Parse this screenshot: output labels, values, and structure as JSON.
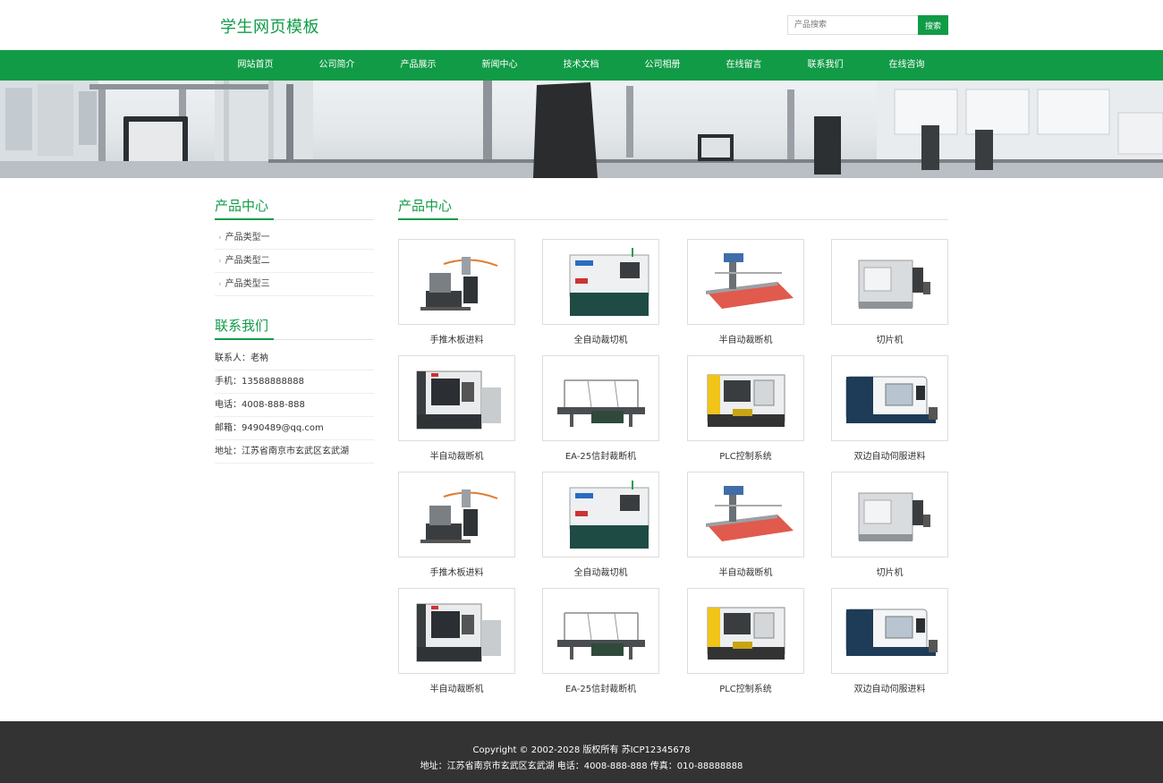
{
  "header": {
    "logo": "学生网页模板",
    "search_placeholder": "产品搜索",
    "search_button": "搜索"
  },
  "nav": {
    "items": [
      "网站首页",
      "公司简介",
      "产品展示",
      "新闻中心",
      "技术文档",
      "公司相册",
      "在线留言",
      "联系我们",
      "在线咨询"
    ]
  },
  "sidebar": {
    "products_title": "产品中心",
    "categories": [
      "产品类型一",
      "产品类型二",
      "产品类型三"
    ],
    "contact_title": "联系我们",
    "contact": [
      "联系人：老衲",
      "手机：13588888888",
      "电话：4008-888-888",
      "邮箱：9490489@qq.com",
      "地址：江苏省南京市玄武区玄武湖"
    ]
  },
  "main": {
    "title": "产品中心",
    "products": [
      {
        "name": "手推木板进料",
        "icon": "glass-edging-machine-icon"
      },
      {
        "name": "全自动裁切机",
        "icon": "cnc-cabinet-icon"
      },
      {
        "name": "半自动裁断机",
        "icon": "glass-cutting-table-icon"
      },
      {
        "name": "切片机",
        "icon": "slicing-machine-icon"
      },
      {
        "name": "半自动裁断机",
        "icon": "cnc-lathe-icon"
      },
      {
        "name": "EA-25信封裁断机",
        "icon": "envelope-cutter-icon"
      },
      {
        "name": "PLC控制系统",
        "icon": "plc-lathe-icon"
      },
      {
        "name": "双边自动伺服进料",
        "icon": "servo-machine-icon"
      },
      {
        "name": "手推木板进料",
        "icon": "glass-edging-machine-icon"
      },
      {
        "name": "全自动裁切机",
        "icon": "cnc-cabinet-icon"
      },
      {
        "name": "半自动裁断机",
        "icon": "glass-cutting-table-icon"
      },
      {
        "name": "切片机",
        "icon": "slicing-machine-icon"
      },
      {
        "name": "半自动裁断机",
        "icon": "cnc-lathe-icon"
      },
      {
        "name": "EA-25信封裁断机",
        "icon": "envelope-cutter-icon"
      },
      {
        "name": "PLC控制系统",
        "icon": "plc-lathe-icon"
      },
      {
        "name": "双边自动伺服进料",
        "icon": "servo-machine-icon"
      }
    ]
  },
  "footer": {
    "copyright": "Copyright © 2002-2028 版权所有 苏ICP12345678",
    "address": "地址：江苏省南京市玄武区玄武湖 电话：4008-888-888 传真：010-88888888"
  },
  "colors": {
    "brand_green": "#119b47",
    "footer_bg": "#333333"
  }
}
